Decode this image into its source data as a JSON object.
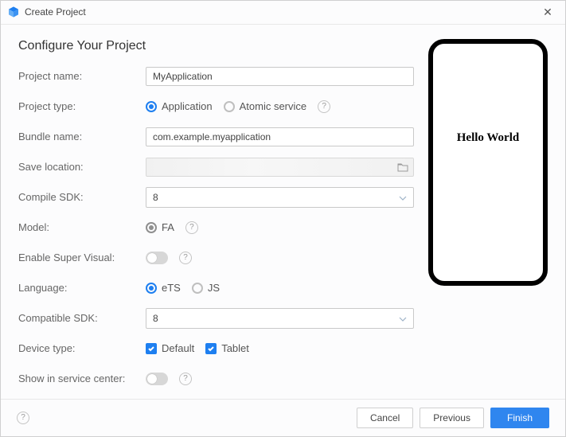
{
  "window": {
    "title": "Create Project"
  },
  "heading": "Configure Your Project",
  "labels": {
    "projectName": "Project name:",
    "projectType": "Project type:",
    "bundleName": "Bundle name:",
    "saveLocation": "Save location:",
    "compileSdk": "Compile SDK:",
    "model": "Model:",
    "enableSuperVisual": "Enable Super Visual:",
    "language": "Language:",
    "compatibleSdk": "Compatible SDK:",
    "deviceType": "Device type:",
    "showInServiceCenter": "Show in service center:"
  },
  "values": {
    "projectName": "MyApplication",
    "bundleName": "com.example.myapplication",
    "compileSdk": "8",
    "compatibleSdk": "8"
  },
  "options": {
    "projectType": {
      "application": "Application",
      "atomicService": "Atomic service"
    },
    "model": {
      "fa": "FA"
    },
    "language": {
      "ets": "eTS",
      "js": "JS"
    },
    "deviceType": {
      "default": "Default",
      "tablet": "Tablet"
    }
  },
  "preview": {
    "text": "Hello World"
  },
  "footer": {
    "cancel": "Cancel",
    "previous": "Previous",
    "finish": "Finish"
  }
}
